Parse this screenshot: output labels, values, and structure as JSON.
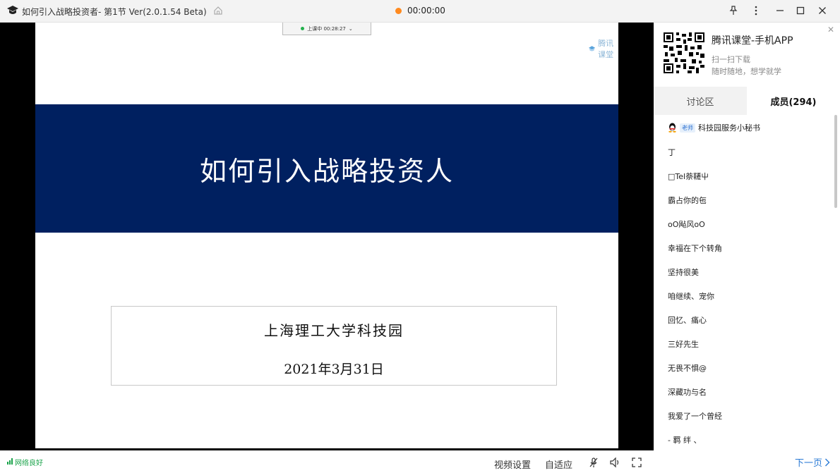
{
  "window": {
    "title": "如何引入战略投资者- 第1节 Ver(2.0.1.54 Beta)",
    "timer": "00:00:00",
    "record_color": "#ff8a1f"
  },
  "slide": {
    "class_status": "上课中 00:28:27",
    "watermark": "腾讯课堂",
    "title": "如何引入战略投资人",
    "organization": "上海理工大学科技园",
    "date": "2021年3月31日",
    "band_color": "#002060"
  },
  "bottom_bar": {
    "network": "网络良好",
    "video_settings": "视频设置",
    "adaptive": "自适应",
    "network_color": "#1aa34a"
  },
  "right_panel": {
    "app_name": "腾讯课堂-手机APP",
    "scan_text": "扫一扫下载",
    "slogan": "随时随地，想学就学",
    "tabs": [
      {
        "label": "讨论区"
      },
      {
        "label": "成员(294)"
      }
    ],
    "teacher_badge": "老师",
    "members": [
      {
        "name": "科技园服务小秘书"
      },
      {
        "name": "丁"
      },
      {
        "name": "□Tel萘韆屮"
      },
      {
        "name": "霸占你的㐌"
      },
      {
        "name": "oO飐风oO"
      },
      {
        "name": "幸福在下个转角"
      },
      {
        "name": "坚持很美"
      },
      {
        "name": "咱继续、宠你"
      },
      {
        "name": "回忆、痛心"
      },
      {
        "name": "三好先生"
      },
      {
        "name": "无畏不惧@"
      },
      {
        "name": "深藏功与名"
      },
      {
        "name": "我爱了一个曾经"
      },
      {
        "name": "- 羁 绊 、"
      }
    ],
    "next_page": "下一页",
    "accent_color": "#2a7ad5"
  }
}
